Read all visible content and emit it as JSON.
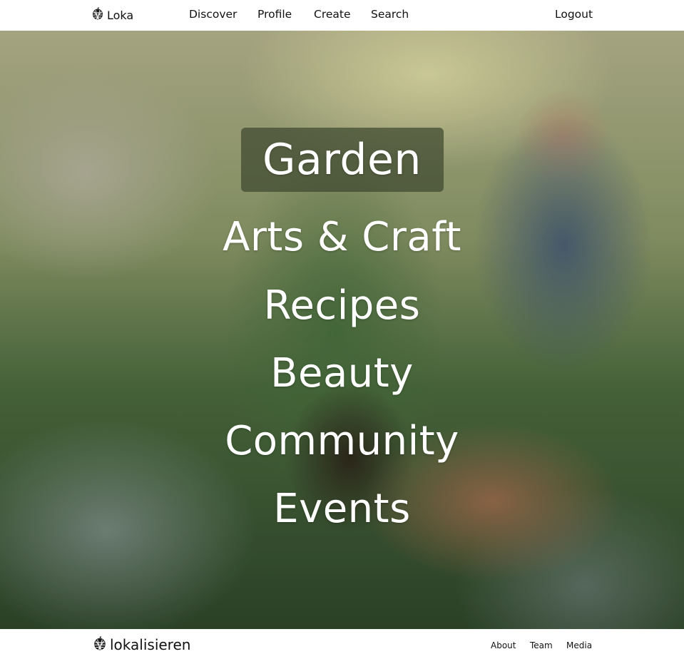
{
  "topnav": {
    "brand": {
      "icon": "pinecone-logo-icon",
      "label": "Loka"
    },
    "links": [
      {
        "label": "Discover"
      },
      {
        "label": "Profile"
      },
      {
        "label": "Create"
      },
      {
        "label": "Search"
      }
    ],
    "logout": "Logout"
  },
  "hero": {
    "categories": [
      {
        "label": "Garden",
        "active": true
      },
      {
        "label": "Arts & Craft"
      },
      {
        "label": "Recipes"
      },
      {
        "label": "Beauty"
      },
      {
        "label": "Community"
      },
      {
        "label": "Events"
      }
    ]
  },
  "footer": {
    "brand": {
      "icon": "pinecone-logo-icon",
      "label": "lokalisieren"
    },
    "links": [
      {
        "label": "About"
      },
      {
        "label": "Team"
      },
      {
        "label": "Media"
      }
    ]
  },
  "colors": {
    "nav_background": "#ffffff",
    "text": "#111111",
    "category_text": "#ffffff",
    "active_highlight": "#3c462d"
  }
}
